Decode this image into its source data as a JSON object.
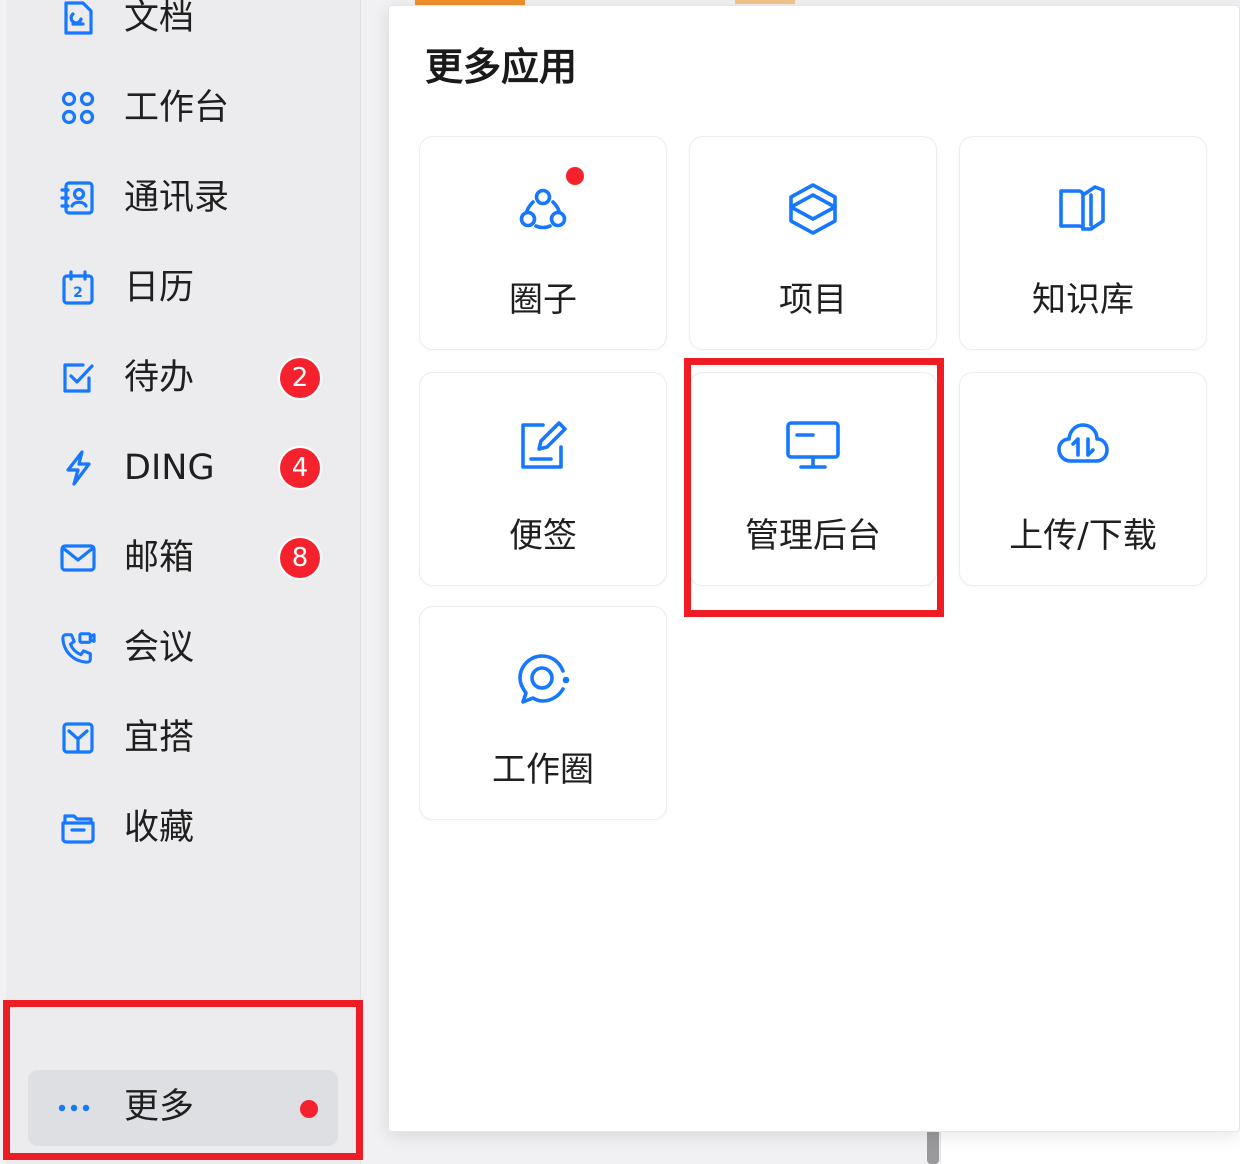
{
  "sidebar": {
    "items": [
      {
        "label": "文档",
        "icon": "document-icon",
        "badge": ""
      },
      {
        "label": "工作台",
        "icon": "workbench-grid-icon",
        "badge": ""
      },
      {
        "label": "通讯录",
        "icon": "contacts-icon",
        "badge": ""
      },
      {
        "label": "日历",
        "icon": "calendar-icon",
        "badge": ""
      },
      {
        "label": "待办",
        "icon": "todo-check-icon",
        "badge": "2"
      },
      {
        "label": "DING",
        "icon": "lightning-icon",
        "badge": "4"
      },
      {
        "label": "邮箱",
        "icon": "mail-icon",
        "badge": "8"
      },
      {
        "label": "会议",
        "icon": "meeting-phone-icon",
        "badge": ""
      },
      {
        "label": "宜搭",
        "icon": "yida-icon",
        "badge": ""
      },
      {
        "label": "收藏",
        "icon": "folder-icon",
        "badge": ""
      }
    ],
    "more": {
      "label": "更多",
      "icon": "more-dots-icon",
      "has_dot": true
    }
  },
  "panel": {
    "title": "更多应用",
    "apps": [
      {
        "label": "圈子",
        "icon": "circle-group-icon",
        "has_dot": true
      },
      {
        "label": "项目",
        "icon": "project-cube-icon",
        "has_dot": false
      },
      {
        "label": "知识库",
        "icon": "knowledge-book-icon",
        "has_dot": false
      },
      {
        "label": "便签",
        "icon": "note-edit-icon",
        "has_dot": false
      },
      {
        "label": "管理后台",
        "icon": "admin-monitor-icon",
        "has_dot": false
      },
      {
        "label": "上传/下载",
        "icon": "cloud-transfer-icon",
        "has_dot": false
      },
      {
        "label": "工作圈",
        "icon": "work-circle-icon",
        "has_dot": false
      }
    ]
  },
  "colors": {
    "accent": "#1677ff",
    "badge": "#f5222d",
    "highlight": "#ee1c24"
  }
}
